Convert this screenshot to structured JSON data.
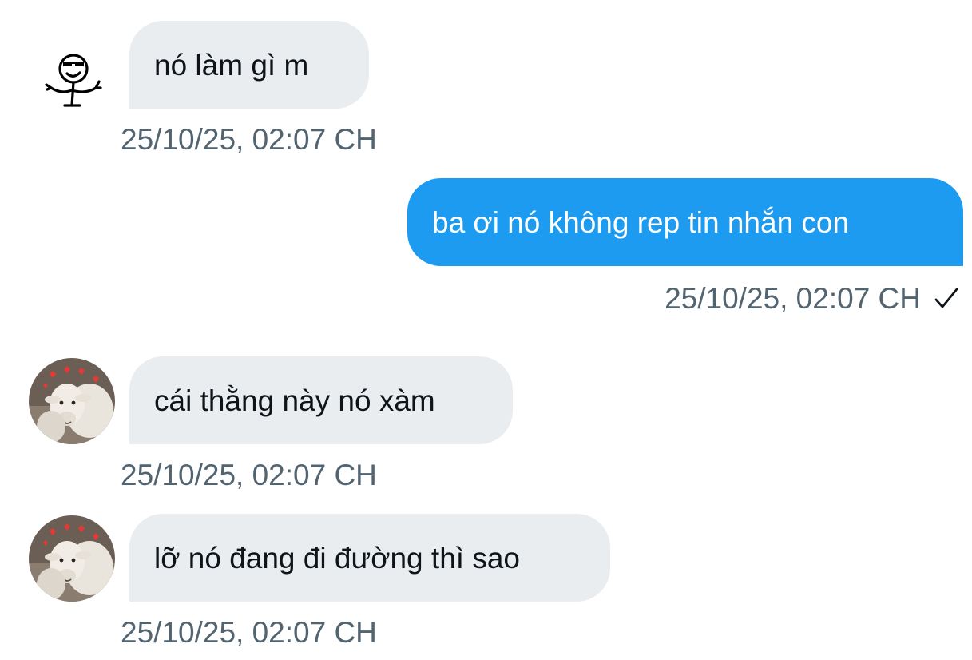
{
  "messages": [
    {
      "direction": "incoming",
      "avatar": "stick-figure-sticker-icon",
      "text": "nó làm gì m",
      "time": "25/10/25, 02:07 CH"
    },
    {
      "direction": "outgoing",
      "text": "ba ơi nó không rep tin nhắn con",
      "time": "25/10/25, 02:07 CH",
      "status_icon": "check-icon"
    },
    {
      "direction": "incoming",
      "avatar": "goat-avatar",
      "text": "cái thằng này nó xàm",
      "time": "25/10/25, 02:07 CH"
    },
    {
      "direction": "incoming",
      "avatar": "goat-avatar",
      "text": "lỡ nó đang đi đường thì sao",
      "time": "25/10/25, 02:07 CH"
    }
  ],
  "colors": {
    "incoming_bubble": "#e9edf0",
    "outgoing_bubble": "#1d9bf0",
    "timestamp": "#536471",
    "text": "#0f1419"
  }
}
